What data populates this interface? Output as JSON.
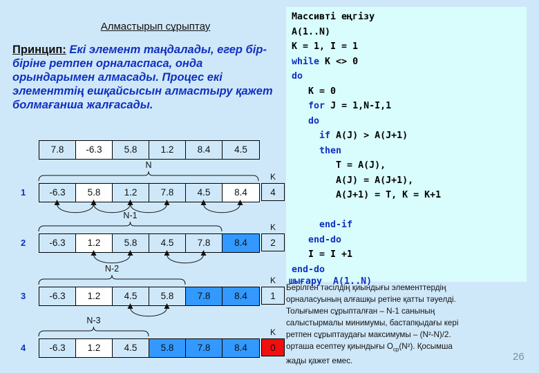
{
  "slide": {
    "title": "Алмастырып сұрыптау",
    "page_number": "26",
    "background_color": "#cfe8f9",
    "accent_color": "#1030c0",
    "sorted_cell_color": "#3399ff",
    "alert_color": "#f01010"
  },
  "principle": {
    "label": "Принцип:",
    "text": "Екі элемент таңдалады, егер бір- біріне ретпен орналаспаса, онда орындарымен алмасады. Процес екі элементтің ешқайсысын алмастыру қажет болмағанша жалғасады."
  },
  "arrays": {
    "initial": {
      "row_label": "",
      "bracket_label": "",
      "k_label": "",
      "k_value": "",
      "cells": [
        {
          "value": "7.8",
          "state": "normal"
        },
        {
          "value": "-6.3",
          "state": "white"
        },
        {
          "value": "5.8",
          "state": "normal"
        },
        {
          "value": "1.2",
          "state": "normal"
        },
        {
          "value": "8.4",
          "state": "normal"
        },
        {
          "value": "4.5",
          "state": "normal"
        }
      ]
    },
    "passes": [
      {
        "row_label": "1",
        "bracket_label": "N",
        "k_label": "K",
        "k_value": "4",
        "k_state": "normal",
        "cells": [
          {
            "value": "-6.3",
            "state": "normal"
          },
          {
            "value": "5.8",
            "state": "white"
          },
          {
            "value": "1.2",
            "state": "normal"
          },
          {
            "value": "7.8",
            "state": "normal"
          },
          {
            "value": "4.5",
            "state": "normal"
          },
          {
            "value": "8.4",
            "state": "white"
          }
        ]
      },
      {
        "row_label": "2",
        "bracket_label": "N-1",
        "k_label": "K",
        "k_value": "2",
        "k_state": "normal",
        "cells": [
          {
            "value": "-6.3",
            "state": "normal"
          },
          {
            "value": "1.2",
            "state": "white"
          },
          {
            "value": "5.8",
            "state": "normal"
          },
          {
            "value": "4.5",
            "state": "normal"
          },
          {
            "value": "7.8",
            "state": "normal"
          },
          {
            "value": "8.4",
            "state": "sorted"
          }
        ]
      },
      {
        "row_label": "3",
        "bracket_label": "N-2",
        "k_label": "K",
        "k_value": "1",
        "k_state": "normal",
        "cells": [
          {
            "value": "-6.3",
            "state": "normal"
          },
          {
            "value": "1.2",
            "state": "white"
          },
          {
            "value": "4.5",
            "state": "normal"
          },
          {
            "value": "5.8",
            "state": "normal"
          },
          {
            "value": "7.8",
            "state": "sorted"
          },
          {
            "value": "8.4",
            "state": "sorted"
          }
        ]
      },
      {
        "row_label": "4",
        "bracket_label": "N-3",
        "k_label": "K",
        "k_value": "0",
        "k_state": "red",
        "cells": [
          {
            "value": "-6.3",
            "state": "normal"
          },
          {
            "value": "1.2",
            "state": "white"
          },
          {
            "value": "4.5",
            "state": "normal"
          },
          {
            "value": "5.8",
            "state": "sorted"
          },
          {
            "value": "7.8",
            "state": "sorted"
          },
          {
            "value": "8.4",
            "state": "sorted"
          }
        ]
      }
    ]
  },
  "code": {
    "lines": [
      [
        {
          "t": "Массивті еңгізу",
          "c": "plain"
        }
      ],
      [
        {
          "t": "A(1..N)",
          "c": "plain"
        }
      ],
      [
        {
          "t": "K = 1, I = 1",
          "c": "plain"
        }
      ],
      [
        {
          "t": "while",
          "c": "kw"
        },
        {
          "t": " K <> 0",
          "c": "plain"
        }
      ],
      [
        {
          "t": "do",
          "c": "kw"
        }
      ],
      [
        {
          "t": "   K = 0",
          "c": "plain"
        }
      ],
      [
        {
          "t": "   ",
          "c": "plain"
        },
        {
          "t": "for",
          "c": "kw"
        },
        {
          "t": " J = 1,N-I,1",
          "c": "plain"
        }
      ],
      [
        {
          "t": "   ",
          "c": "plain"
        },
        {
          "t": "do",
          "c": "kw"
        }
      ],
      [
        {
          "t": "     ",
          "c": "plain"
        },
        {
          "t": "if",
          "c": "kw"
        },
        {
          "t": " A(J) > A(J+1)",
          "c": "plain"
        }
      ],
      [
        {
          "t": "     ",
          "c": "plain"
        },
        {
          "t": "then",
          "c": "kw"
        }
      ],
      [
        {
          "t": "        T = A(J),",
          "c": "plain"
        }
      ],
      [
        {
          "t": "        A(J) = A(J+1),",
          "c": "plain"
        }
      ],
      [
        {
          "t": "        A(J+1) = T, K = K+1",
          "c": "plain"
        }
      ],
      [
        {
          "t": "",
          "c": "plain"
        }
      ],
      [
        {
          "t": "     ",
          "c": "plain"
        },
        {
          "t": "end-if",
          "c": "kw"
        }
      ],
      [
        {
          "t": "   ",
          "c": "plain"
        },
        {
          "t": "end-do",
          "c": "kw"
        }
      ],
      [
        {
          "t": "   I = I +1",
          "c": "plain"
        }
      ],
      [
        {
          "t": "end-do",
          "c": "kw"
        }
      ]
    ],
    "overlap_line": "шығару  A(1..N)"
  },
  "summary": {
    "lines": [
      "Берілген тәсілдің қиындығы элементтердің",
      "орналасуының алғашқы ретіне қатты тәуелді.",
      "Толығымен сұрыпталған – N-1 санының",
      "салыстырмалы минимумы,  бастапқыдағы кері",
      "ретпен сұрыптаудағы максимумы – (N²-N)/2.",
      "орташа есептеу қиындығы O_cp(N²).  Қосымша",
      "жады қажет емес."
    ],
    "line6_a": "орташа есептеу қиындығы O",
    "line6_sub": "ср",
    "line6_b": "(N²).  Қосымша"
  }
}
